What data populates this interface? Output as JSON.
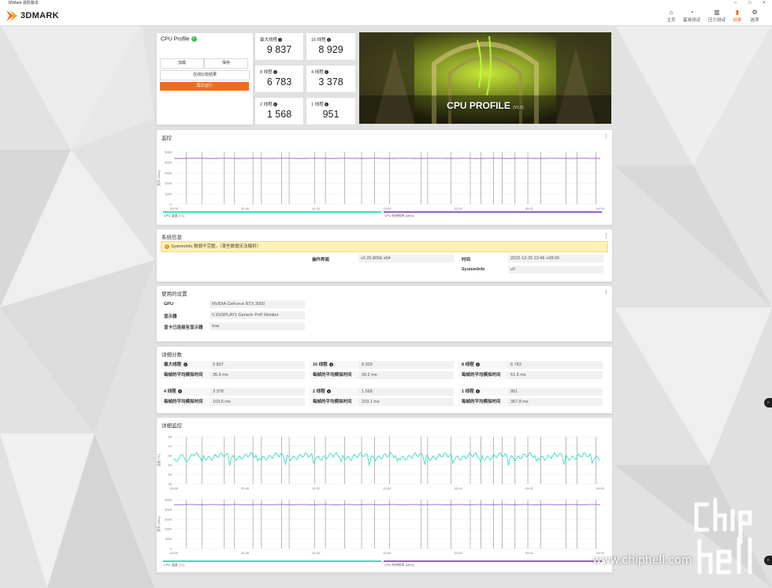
{
  "window": {
    "title": "3DMark 进阶版本"
  },
  "app": {
    "logo": "3DMARK",
    "nav": [
      {
        "label": "主页",
        "icon": "home-icon"
      },
      {
        "label": "基准测试",
        "icon": "gauge-icon"
      },
      {
        "label": "压力测试",
        "icon": "bars-icon"
      },
      {
        "label": "结果",
        "icon": "chart-icon"
      },
      {
        "label": "选项",
        "icon": "gear-icon"
      }
    ],
    "active_nav": "结果"
  },
  "profile": {
    "title": "CPU Profile",
    "load_label": "加载",
    "save_label": "保存",
    "compare_label": "在线比较结果",
    "run_again_label": "再次运行"
  },
  "scores": [
    {
      "label": "最大线程",
      "value": "9 837"
    },
    {
      "label": "16 线程",
      "value": "8 929"
    },
    {
      "label": "8 线程",
      "value": "6 783"
    },
    {
      "label": "4 线程",
      "value": "3 378"
    },
    {
      "label": "2 线程",
      "value": "1 568"
    },
    {
      "label": "1 线程",
      "value": "951"
    }
  ],
  "hero": {
    "title": "CPU PROFILE",
    "version": "(V1.0)"
  },
  "monitor": {
    "title": "监控",
    "y_axis": "频率 (MHz)",
    "y_ticks": [
      "5000",
      "4000",
      "3000",
      "2000",
      "1000",
      "0"
    ],
    "x_ticks": [
      "00:00",
      "00:40",
      "01:20",
      "02:00",
      "02:40",
      "03:20",
      "04:00"
    ],
    "legend": [
      "CPU 温度 (°C)",
      "CPU 时钟频率 (MHz)"
    ]
  },
  "sysinfo": {
    "title": "系统信息",
    "warning": "SystemInfo 数据不完整。（某些数据无法解析）",
    "rows": [
      {
        "label": "操作界面",
        "value": "v2.25.8056 s64",
        "label2": "时间",
        "value2": "2022-12-25 23:46 +08:00"
      },
      {
        "label2": "SystemInfo",
        "value2": "v0"
      }
    ]
  },
  "settings": {
    "title": "使用的设置",
    "rows": [
      {
        "label": "GPU",
        "value": "NVIDIA GeForce RTX 3050"
      },
      {
        "label": "显示器",
        "value": "\\\\.\\DISPLAY1 Generic PnP Monitor"
      },
      {
        "label": "显卡已连接至显示器",
        "value": "true"
      }
    ]
  },
  "detail_scores": {
    "title": "详细分数",
    "groups": [
      {
        "label": "最大线程",
        "value": "9 837",
        "sub_label": "每帧的平均模拟时间",
        "sub_value": "35.6 ms"
      },
      {
        "label": "16 线程",
        "value": "8 929",
        "sub_label": "每帧的平均模拟时间",
        "sub_value": "39.2 ms"
      },
      {
        "label": "8 线程",
        "value": "6 783",
        "sub_label": "每帧的平均模拟时间",
        "sub_value": "51.6 ms"
      },
      {
        "label": "4 线程",
        "value": "3 378",
        "sub_label": "每帧的平均模拟时间",
        "sub_value": "103.6 ms"
      },
      {
        "label": "2 线程",
        "value": "1 568",
        "sub_label": "每帧的平均模拟时间",
        "sub_value": "223.1 ms"
      },
      {
        "label": "1 线程",
        "value": "951",
        "sub_label": "每帧的平均模拟时间",
        "sub_value": "367.8 ms"
      }
    ]
  },
  "detail_monitor": {
    "title": "详细监控",
    "temp_axis": "温度 (°C)",
    "temp_ticks": [
      "80",
      "70",
      "60",
      "50",
      "40",
      "30"
    ],
    "freq_axis": "频率 (MHz)",
    "freq_ticks": [
      "5000",
      "4000",
      "3000",
      "2000",
      "1000",
      "0"
    ],
    "x_ticks": [
      "00:00",
      "00:40",
      "01:20",
      "02:00",
      "02:40",
      "03:20",
      "04:00"
    ],
    "legend": [
      "CPU 温度 (°C)",
      "CPU 时钟频率 (MHz)"
    ]
  },
  "watermark": {
    "site": "www.chiphell.com",
    "logo": "chip hell"
  },
  "colors": {
    "accent": "#f46a1f",
    "teal": "#35e0c0",
    "purple": "#9b5cc8"
  }
}
